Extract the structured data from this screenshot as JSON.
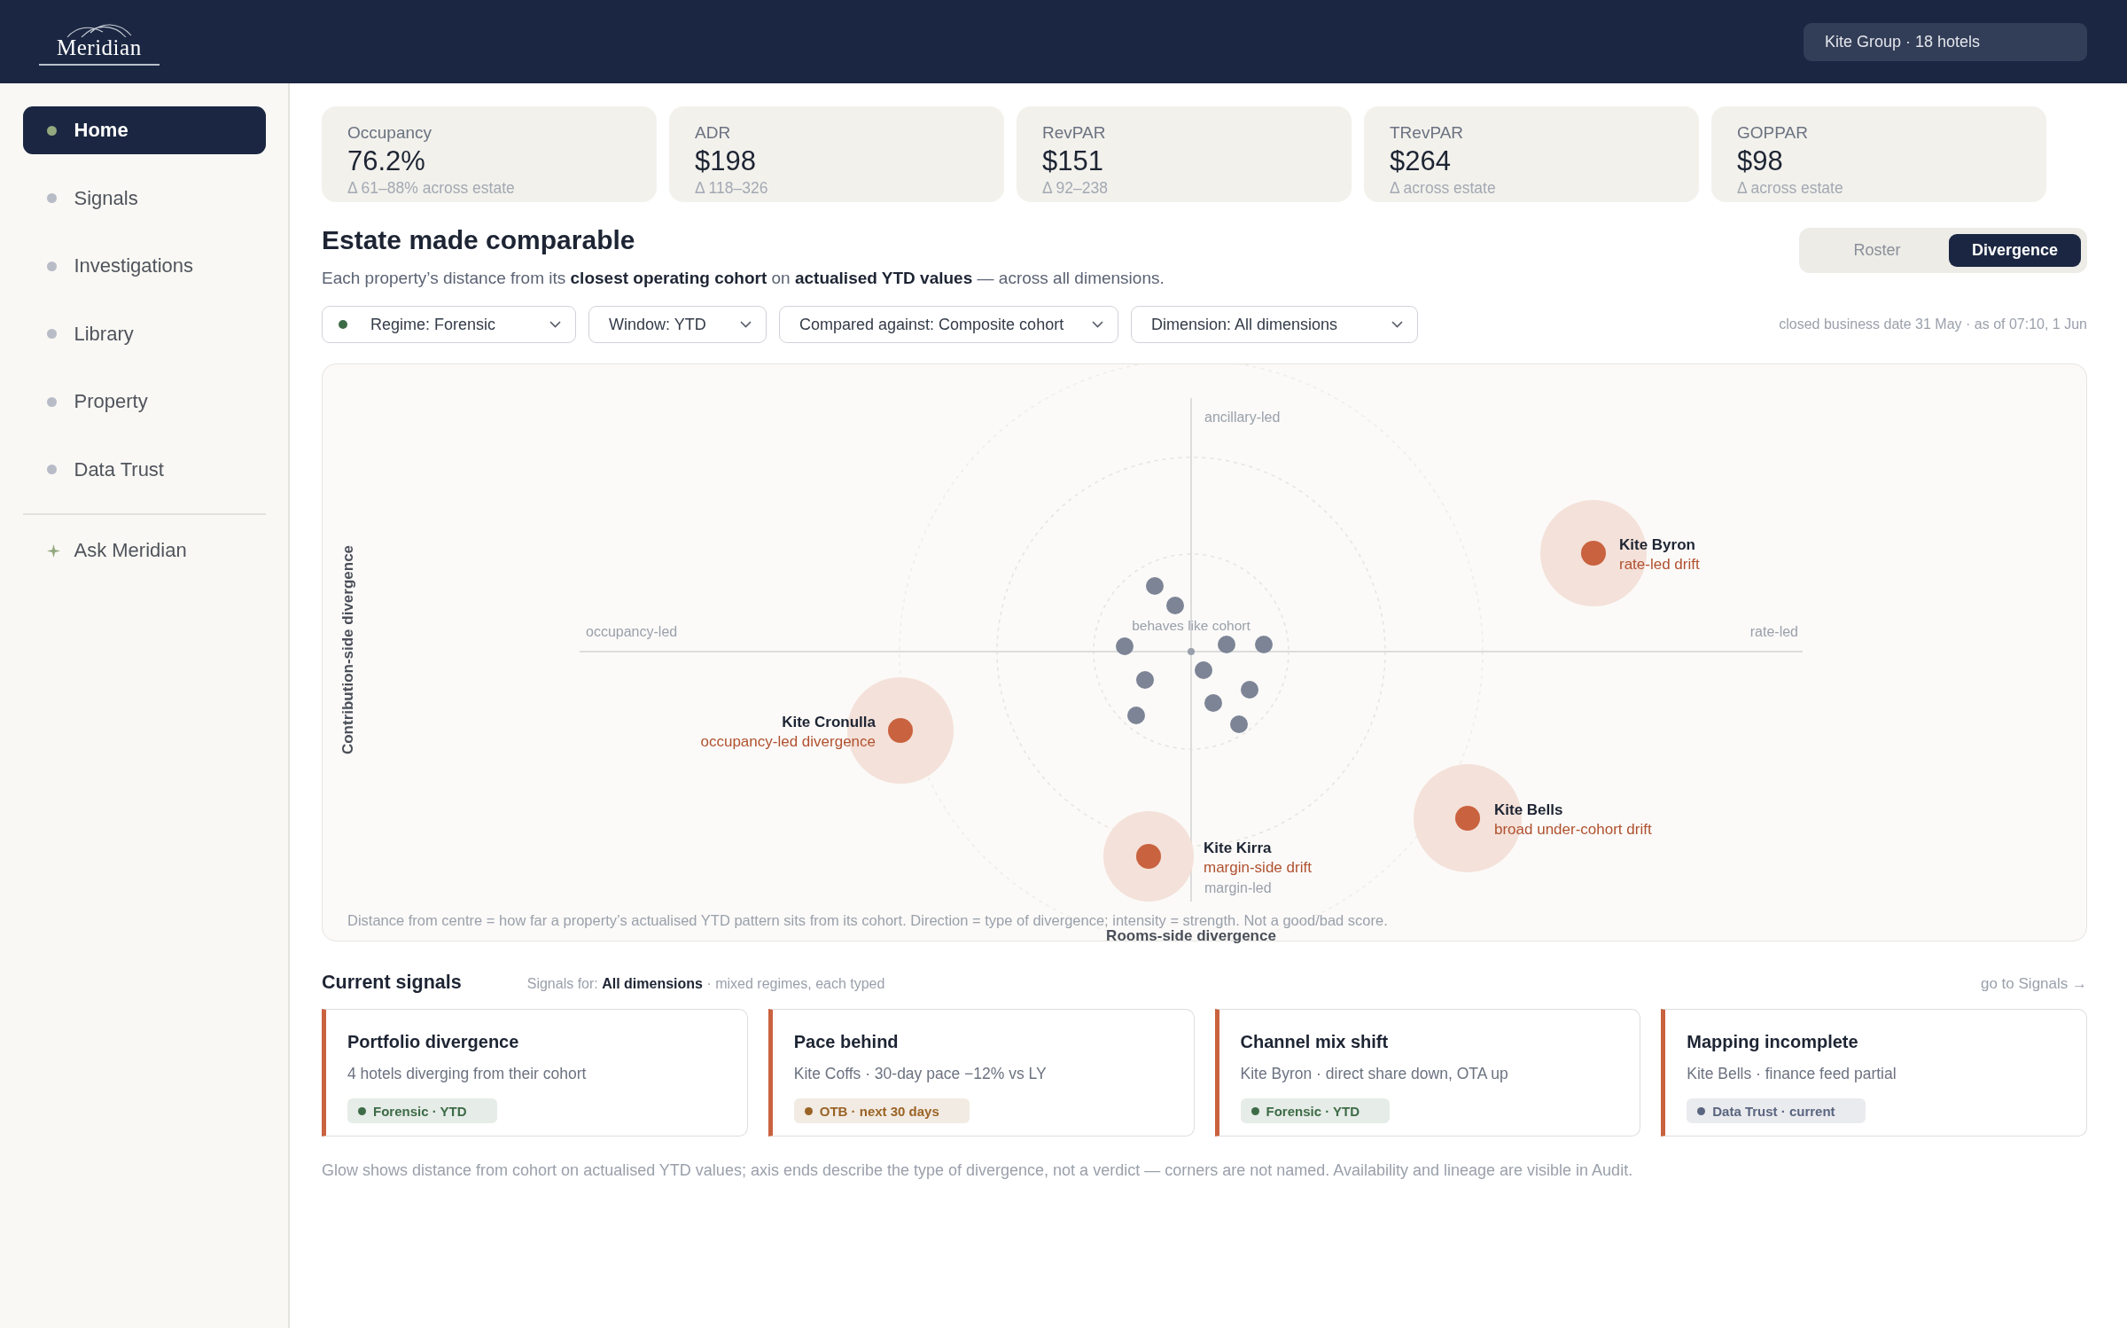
{
  "brand": {
    "name": "Meridian"
  },
  "estate_selector": {
    "label": "Kite Group · 18 hotels"
  },
  "sidebar": {
    "items": [
      {
        "label": "Home",
        "selected": true
      },
      {
        "label": "Signals",
        "selected": false
      },
      {
        "label": "Investigations",
        "selected": false
      },
      {
        "label": "Library",
        "selected": false
      },
      {
        "label": "Property",
        "selected": false
      },
      {
        "label": "Data Trust",
        "selected": false
      }
    ],
    "assistant": {
      "label": "Ask Meridian"
    }
  },
  "kpis": [
    {
      "label": "Occupancy",
      "value": "76.2%",
      "range": "Δ 61–88% across estate"
    },
    {
      "label": "ADR",
      "value": "$198",
      "range": "Δ 118–326"
    },
    {
      "label": "RevPAR",
      "value": "$151",
      "range": "Δ 92–238"
    },
    {
      "label": "TRevPAR",
      "value": "$264",
      "range": "Δ across estate"
    },
    {
      "label": "GOPPAR",
      "value": "$98",
      "range": "Δ across estate"
    }
  ],
  "section": {
    "title": "Estate made comparable",
    "subtitle": "Each property’s distance from its **closest operating cohort** on **actualised YTD values** — across all dimensions.",
    "view_toggle": [
      {
        "label": "Roster",
        "selected": false
      },
      {
        "label": "Divergence",
        "selected": true
      }
    ],
    "filters": [
      {
        "label": "Regime: Forensic",
        "color": "#3d6b47"
      },
      {
        "label": "Window: YTD"
      },
      {
        "label": "Compared against: Composite cohort"
      },
      {
        "label": "Dimension: All dimensions"
      }
    ],
    "as_of": "closed business date 31 May · as of 07:10, 1 Jun"
  },
  "divergence_map": {
    "y_title": "Contribution-side divergence",
    "x_title": "Rooms-side divergence",
    "axis_ends": {
      "top": "ancillary-led",
      "left": "occupancy-led",
      "right": "rate-led",
      "bottom": "margin-led"
    },
    "centre_label": "behaves like cohort",
    "outliers": [
      {
        "name": "Kite Byron",
        "note": "rate-led drift"
      },
      {
        "name": "Kite Cronulla",
        "note": "occupancy-led divergence"
      },
      {
        "name": "Kite Kirra",
        "note": "margin-side drift"
      },
      {
        "name": "Kite Bells",
        "note": "broad under-cohort drift"
      }
    ],
    "footnote": "Distance from centre = how far a property’s actualised YTD pattern sits from its cohort. Direction = type of divergence; intensity = strength. Not a good/bad score."
  },
  "signals": {
    "title": "Current signals",
    "scope": "Signals for: **All dimensions** · mixed regimes, each typed",
    "link": "go to Signals →",
    "cards": [
      {
        "title": "Portfolio divergence",
        "detail": "4 hotels diverging from their cohort",
        "tag": {
          "label": "Forensic · YTD",
          "color": "#3d6b47"
        }
      },
      {
        "title": "Pace behind",
        "detail": "Kite Coffs · 30-day pace −12% vs LY",
        "tag": {
          "label": "OTB · next 30 days",
          "color": "#9a6326"
        }
      },
      {
        "title": "Channel mix shift",
        "detail": "Kite Byron · direct share down, OTA up",
        "tag": {
          "label": "Forensic · YTD",
          "color": "#3d6b47"
        }
      },
      {
        "title": "Mapping incomplete",
        "detail": "Kite Bells · finance feed partial",
        "tag": {
          "label": "Data Trust · current",
          "color": "#5a6580"
        }
      }
    ],
    "footnote": "Glow shows distance from cohort on actualised YTD values; axis ends describe the type of divergence, not a verdict — corners are not named. Availability and lineage are visible in Audit."
  }
}
